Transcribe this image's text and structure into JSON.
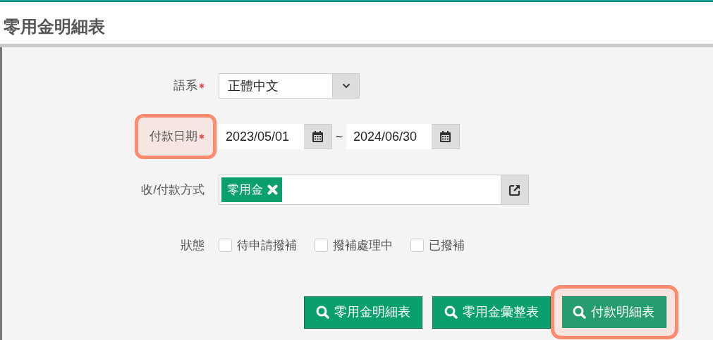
{
  "page_title": "零用金明細表",
  "fields": [
    {
      "kind": "select",
      "label": "語系",
      "required": true,
      "highlighted": false,
      "value": "正體中文"
    },
    {
      "kind": "date_range",
      "label": "付款日期",
      "required": true,
      "highlighted": true,
      "from": "2023/05/01",
      "separator": "~",
      "to": "2024/06/30"
    },
    {
      "kind": "tags",
      "label": "收/付款方式",
      "required": false,
      "highlighted": false,
      "tags": [
        "零用金"
      ]
    },
    {
      "kind": "checkboxes",
      "label": "狀態",
      "required": false,
      "highlighted": false,
      "options": [
        {
          "label": "待申請撥補",
          "checked": false
        },
        {
          "label": "撥補處理中",
          "checked": false
        },
        {
          "label": "已撥補",
          "checked": false
        }
      ]
    }
  ],
  "buttons": [
    {
      "label": "零用金明細表",
      "highlighted": false
    },
    {
      "label": "零用金彙整表",
      "highlighted": false
    },
    {
      "label": "付款明細表",
      "highlighted": true
    }
  ]
}
